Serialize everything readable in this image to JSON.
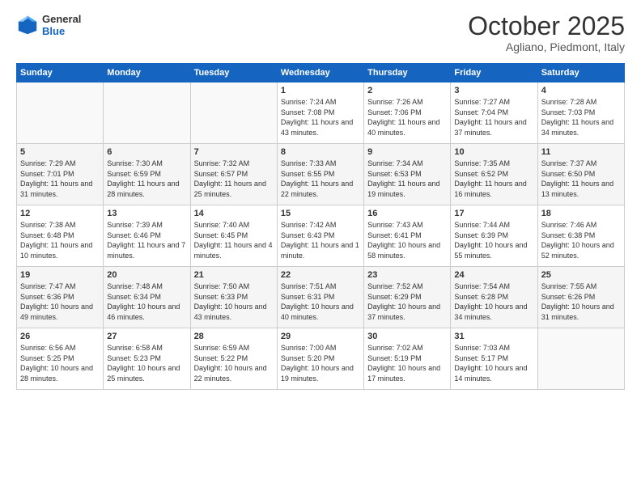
{
  "logo": {
    "general": "General",
    "blue": "Blue"
  },
  "title": {
    "month": "October 2025",
    "location": "Agliano, Piedmont, Italy"
  },
  "weekdays": [
    "Sunday",
    "Monday",
    "Tuesday",
    "Wednesday",
    "Thursday",
    "Friday",
    "Saturday"
  ],
  "weeks": [
    [
      {
        "day": "",
        "sunrise": "",
        "sunset": "",
        "daylight": ""
      },
      {
        "day": "",
        "sunrise": "",
        "sunset": "",
        "daylight": ""
      },
      {
        "day": "",
        "sunrise": "",
        "sunset": "",
        "daylight": ""
      },
      {
        "day": "1",
        "sunrise": "Sunrise: 7:24 AM",
        "sunset": "Sunset: 7:08 PM",
        "daylight": "Daylight: 11 hours and 43 minutes."
      },
      {
        "day": "2",
        "sunrise": "Sunrise: 7:26 AM",
        "sunset": "Sunset: 7:06 PM",
        "daylight": "Daylight: 11 hours and 40 minutes."
      },
      {
        "day": "3",
        "sunrise": "Sunrise: 7:27 AM",
        "sunset": "Sunset: 7:04 PM",
        "daylight": "Daylight: 11 hours and 37 minutes."
      },
      {
        "day": "4",
        "sunrise": "Sunrise: 7:28 AM",
        "sunset": "Sunset: 7:03 PM",
        "daylight": "Daylight: 11 hours and 34 minutes."
      }
    ],
    [
      {
        "day": "5",
        "sunrise": "Sunrise: 7:29 AM",
        "sunset": "Sunset: 7:01 PM",
        "daylight": "Daylight: 11 hours and 31 minutes."
      },
      {
        "day": "6",
        "sunrise": "Sunrise: 7:30 AM",
        "sunset": "Sunset: 6:59 PM",
        "daylight": "Daylight: 11 hours and 28 minutes."
      },
      {
        "day": "7",
        "sunrise": "Sunrise: 7:32 AM",
        "sunset": "Sunset: 6:57 PM",
        "daylight": "Daylight: 11 hours and 25 minutes."
      },
      {
        "day": "8",
        "sunrise": "Sunrise: 7:33 AM",
        "sunset": "Sunset: 6:55 PM",
        "daylight": "Daylight: 11 hours and 22 minutes."
      },
      {
        "day": "9",
        "sunrise": "Sunrise: 7:34 AM",
        "sunset": "Sunset: 6:53 PM",
        "daylight": "Daylight: 11 hours and 19 minutes."
      },
      {
        "day": "10",
        "sunrise": "Sunrise: 7:35 AM",
        "sunset": "Sunset: 6:52 PM",
        "daylight": "Daylight: 11 hours and 16 minutes."
      },
      {
        "day": "11",
        "sunrise": "Sunrise: 7:37 AM",
        "sunset": "Sunset: 6:50 PM",
        "daylight": "Daylight: 11 hours and 13 minutes."
      }
    ],
    [
      {
        "day": "12",
        "sunrise": "Sunrise: 7:38 AM",
        "sunset": "Sunset: 6:48 PM",
        "daylight": "Daylight: 11 hours and 10 minutes."
      },
      {
        "day": "13",
        "sunrise": "Sunrise: 7:39 AM",
        "sunset": "Sunset: 6:46 PM",
        "daylight": "Daylight: 11 hours and 7 minutes."
      },
      {
        "day": "14",
        "sunrise": "Sunrise: 7:40 AM",
        "sunset": "Sunset: 6:45 PM",
        "daylight": "Daylight: 11 hours and 4 minutes."
      },
      {
        "day": "15",
        "sunrise": "Sunrise: 7:42 AM",
        "sunset": "Sunset: 6:43 PM",
        "daylight": "Daylight: 11 hours and 1 minute."
      },
      {
        "day": "16",
        "sunrise": "Sunrise: 7:43 AM",
        "sunset": "Sunset: 6:41 PM",
        "daylight": "Daylight: 10 hours and 58 minutes."
      },
      {
        "day": "17",
        "sunrise": "Sunrise: 7:44 AM",
        "sunset": "Sunset: 6:39 PM",
        "daylight": "Daylight: 10 hours and 55 minutes."
      },
      {
        "day": "18",
        "sunrise": "Sunrise: 7:46 AM",
        "sunset": "Sunset: 6:38 PM",
        "daylight": "Daylight: 10 hours and 52 minutes."
      }
    ],
    [
      {
        "day": "19",
        "sunrise": "Sunrise: 7:47 AM",
        "sunset": "Sunset: 6:36 PM",
        "daylight": "Daylight: 10 hours and 49 minutes."
      },
      {
        "day": "20",
        "sunrise": "Sunrise: 7:48 AM",
        "sunset": "Sunset: 6:34 PM",
        "daylight": "Daylight: 10 hours and 46 minutes."
      },
      {
        "day": "21",
        "sunrise": "Sunrise: 7:50 AM",
        "sunset": "Sunset: 6:33 PM",
        "daylight": "Daylight: 10 hours and 43 minutes."
      },
      {
        "day": "22",
        "sunrise": "Sunrise: 7:51 AM",
        "sunset": "Sunset: 6:31 PM",
        "daylight": "Daylight: 10 hours and 40 minutes."
      },
      {
        "day": "23",
        "sunrise": "Sunrise: 7:52 AM",
        "sunset": "Sunset: 6:29 PM",
        "daylight": "Daylight: 10 hours and 37 minutes."
      },
      {
        "day": "24",
        "sunrise": "Sunrise: 7:54 AM",
        "sunset": "Sunset: 6:28 PM",
        "daylight": "Daylight: 10 hours and 34 minutes."
      },
      {
        "day": "25",
        "sunrise": "Sunrise: 7:55 AM",
        "sunset": "Sunset: 6:26 PM",
        "daylight": "Daylight: 10 hours and 31 minutes."
      }
    ],
    [
      {
        "day": "26",
        "sunrise": "Sunrise: 6:56 AM",
        "sunset": "Sunset: 5:25 PM",
        "daylight": "Daylight: 10 hours and 28 minutes."
      },
      {
        "day": "27",
        "sunrise": "Sunrise: 6:58 AM",
        "sunset": "Sunset: 5:23 PM",
        "daylight": "Daylight: 10 hours and 25 minutes."
      },
      {
        "day": "28",
        "sunrise": "Sunrise: 6:59 AM",
        "sunset": "Sunset: 5:22 PM",
        "daylight": "Daylight: 10 hours and 22 minutes."
      },
      {
        "day": "29",
        "sunrise": "Sunrise: 7:00 AM",
        "sunset": "Sunset: 5:20 PM",
        "daylight": "Daylight: 10 hours and 19 minutes."
      },
      {
        "day": "30",
        "sunrise": "Sunrise: 7:02 AM",
        "sunset": "Sunset: 5:19 PM",
        "daylight": "Daylight: 10 hours and 17 minutes."
      },
      {
        "day": "31",
        "sunrise": "Sunrise: 7:03 AM",
        "sunset": "Sunset: 5:17 PM",
        "daylight": "Daylight: 10 hours and 14 minutes."
      },
      {
        "day": "",
        "sunrise": "",
        "sunset": "",
        "daylight": ""
      }
    ]
  ]
}
